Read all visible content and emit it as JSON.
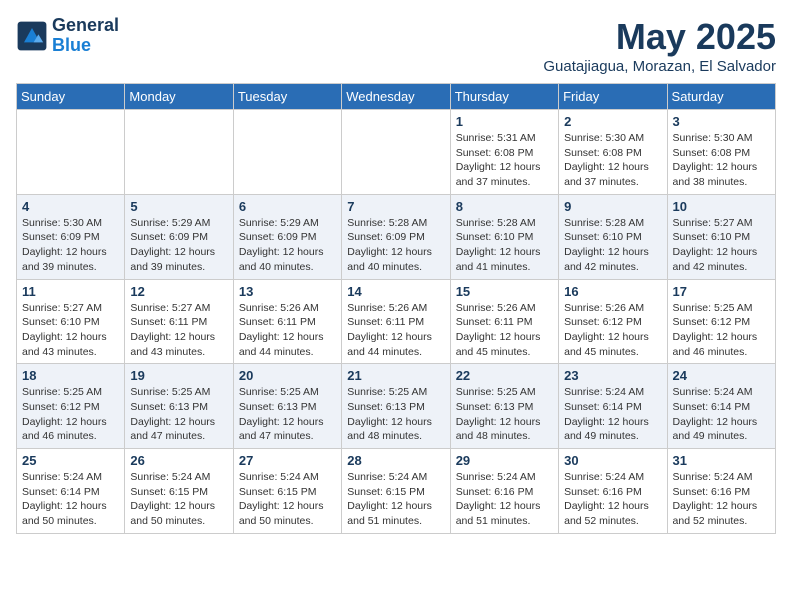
{
  "logo": {
    "line1": "General",
    "line2": "Blue"
  },
  "title": "May 2025",
  "location": "Guatajiagua, Morazan, El Salvador",
  "weekdays": [
    "Sunday",
    "Monday",
    "Tuesday",
    "Wednesday",
    "Thursday",
    "Friday",
    "Saturday"
  ],
  "weeks": [
    [
      {
        "day": "",
        "sunrise": "",
        "sunset": "",
        "daylight": ""
      },
      {
        "day": "",
        "sunrise": "",
        "sunset": "",
        "daylight": ""
      },
      {
        "day": "",
        "sunrise": "",
        "sunset": "",
        "daylight": ""
      },
      {
        "day": "",
        "sunrise": "",
        "sunset": "",
        "daylight": ""
      },
      {
        "day": "1",
        "sunrise": "Sunrise: 5:31 AM",
        "sunset": "Sunset: 6:08 PM",
        "daylight": "Daylight: 12 hours and 37 minutes."
      },
      {
        "day": "2",
        "sunrise": "Sunrise: 5:30 AM",
        "sunset": "Sunset: 6:08 PM",
        "daylight": "Daylight: 12 hours and 37 minutes."
      },
      {
        "day": "3",
        "sunrise": "Sunrise: 5:30 AM",
        "sunset": "Sunset: 6:08 PM",
        "daylight": "Daylight: 12 hours and 38 minutes."
      }
    ],
    [
      {
        "day": "4",
        "sunrise": "Sunrise: 5:30 AM",
        "sunset": "Sunset: 6:09 PM",
        "daylight": "Daylight: 12 hours and 39 minutes."
      },
      {
        "day": "5",
        "sunrise": "Sunrise: 5:29 AM",
        "sunset": "Sunset: 6:09 PM",
        "daylight": "Daylight: 12 hours and 39 minutes."
      },
      {
        "day": "6",
        "sunrise": "Sunrise: 5:29 AM",
        "sunset": "Sunset: 6:09 PM",
        "daylight": "Daylight: 12 hours and 40 minutes."
      },
      {
        "day": "7",
        "sunrise": "Sunrise: 5:28 AM",
        "sunset": "Sunset: 6:09 PM",
        "daylight": "Daylight: 12 hours and 40 minutes."
      },
      {
        "day": "8",
        "sunrise": "Sunrise: 5:28 AM",
        "sunset": "Sunset: 6:10 PM",
        "daylight": "Daylight: 12 hours and 41 minutes."
      },
      {
        "day": "9",
        "sunrise": "Sunrise: 5:28 AM",
        "sunset": "Sunset: 6:10 PM",
        "daylight": "Daylight: 12 hours and 42 minutes."
      },
      {
        "day": "10",
        "sunrise": "Sunrise: 5:27 AM",
        "sunset": "Sunset: 6:10 PM",
        "daylight": "Daylight: 12 hours and 42 minutes."
      }
    ],
    [
      {
        "day": "11",
        "sunrise": "Sunrise: 5:27 AM",
        "sunset": "Sunset: 6:10 PM",
        "daylight": "Daylight: 12 hours and 43 minutes."
      },
      {
        "day": "12",
        "sunrise": "Sunrise: 5:27 AM",
        "sunset": "Sunset: 6:11 PM",
        "daylight": "Daylight: 12 hours and 43 minutes."
      },
      {
        "day": "13",
        "sunrise": "Sunrise: 5:26 AM",
        "sunset": "Sunset: 6:11 PM",
        "daylight": "Daylight: 12 hours and 44 minutes."
      },
      {
        "day": "14",
        "sunrise": "Sunrise: 5:26 AM",
        "sunset": "Sunset: 6:11 PM",
        "daylight": "Daylight: 12 hours and 44 minutes."
      },
      {
        "day": "15",
        "sunrise": "Sunrise: 5:26 AM",
        "sunset": "Sunset: 6:11 PM",
        "daylight": "Daylight: 12 hours and 45 minutes."
      },
      {
        "day": "16",
        "sunrise": "Sunrise: 5:26 AM",
        "sunset": "Sunset: 6:12 PM",
        "daylight": "Daylight: 12 hours and 45 minutes."
      },
      {
        "day": "17",
        "sunrise": "Sunrise: 5:25 AM",
        "sunset": "Sunset: 6:12 PM",
        "daylight": "Daylight: 12 hours and 46 minutes."
      }
    ],
    [
      {
        "day": "18",
        "sunrise": "Sunrise: 5:25 AM",
        "sunset": "Sunset: 6:12 PM",
        "daylight": "Daylight: 12 hours and 46 minutes."
      },
      {
        "day": "19",
        "sunrise": "Sunrise: 5:25 AM",
        "sunset": "Sunset: 6:13 PM",
        "daylight": "Daylight: 12 hours and 47 minutes."
      },
      {
        "day": "20",
        "sunrise": "Sunrise: 5:25 AM",
        "sunset": "Sunset: 6:13 PM",
        "daylight": "Daylight: 12 hours and 47 minutes."
      },
      {
        "day": "21",
        "sunrise": "Sunrise: 5:25 AM",
        "sunset": "Sunset: 6:13 PM",
        "daylight": "Daylight: 12 hours and 48 minutes."
      },
      {
        "day": "22",
        "sunrise": "Sunrise: 5:25 AM",
        "sunset": "Sunset: 6:13 PM",
        "daylight": "Daylight: 12 hours and 48 minutes."
      },
      {
        "day": "23",
        "sunrise": "Sunrise: 5:24 AM",
        "sunset": "Sunset: 6:14 PM",
        "daylight": "Daylight: 12 hours and 49 minutes."
      },
      {
        "day": "24",
        "sunrise": "Sunrise: 5:24 AM",
        "sunset": "Sunset: 6:14 PM",
        "daylight": "Daylight: 12 hours and 49 minutes."
      }
    ],
    [
      {
        "day": "25",
        "sunrise": "Sunrise: 5:24 AM",
        "sunset": "Sunset: 6:14 PM",
        "daylight": "Daylight: 12 hours and 50 minutes."
      },
      {
        "day": "26",
        "sunrise": "Sunrise: 5:24 AM",
        "sunset": "Sunset: 6:15 PM",
        "daylight": "Daylight: 12 hours and 50 minutes."
      },
      {
        "day": "27",
        "sunrise": "Sunrise: 5:24 AM",
        "sunset": "Sunset: 6:15 PM",
        "daylight": "Daylight: 12 hours and 50 minutes."
      },
      {
        "day": "28",
        "sunrise": "Sunrise: 5:24 AM",
        "sunset": "Sunset: 6:15 PM",
        "daylight": "Daylight: 12 hours and 51 minutes."
      },
      {
        "day": "29",
        "sunrise": "Sunrise: 5:24 AM",
        "sunset": "Sunset: 6:16 PM",
        "daylight": "Daylight: 12 hours and 51 minutes."
      },
      {
        "day": "30",
        "sunrise": "Sunrise: 5:24 AM",
        "sunset": "Sunset: 6:16 PM",
        "daylight": "Daylight: 12 hours and 52 minutes."
      },
      {
        "day": "31",
        "sunrise": "Sunrise: 5:24 AM",
        "sunset": "Sunset: 6:16 PM",
        "daylight": "Daylight: 12 hours and 52 minutes."
      }
    ]
  ]
}
